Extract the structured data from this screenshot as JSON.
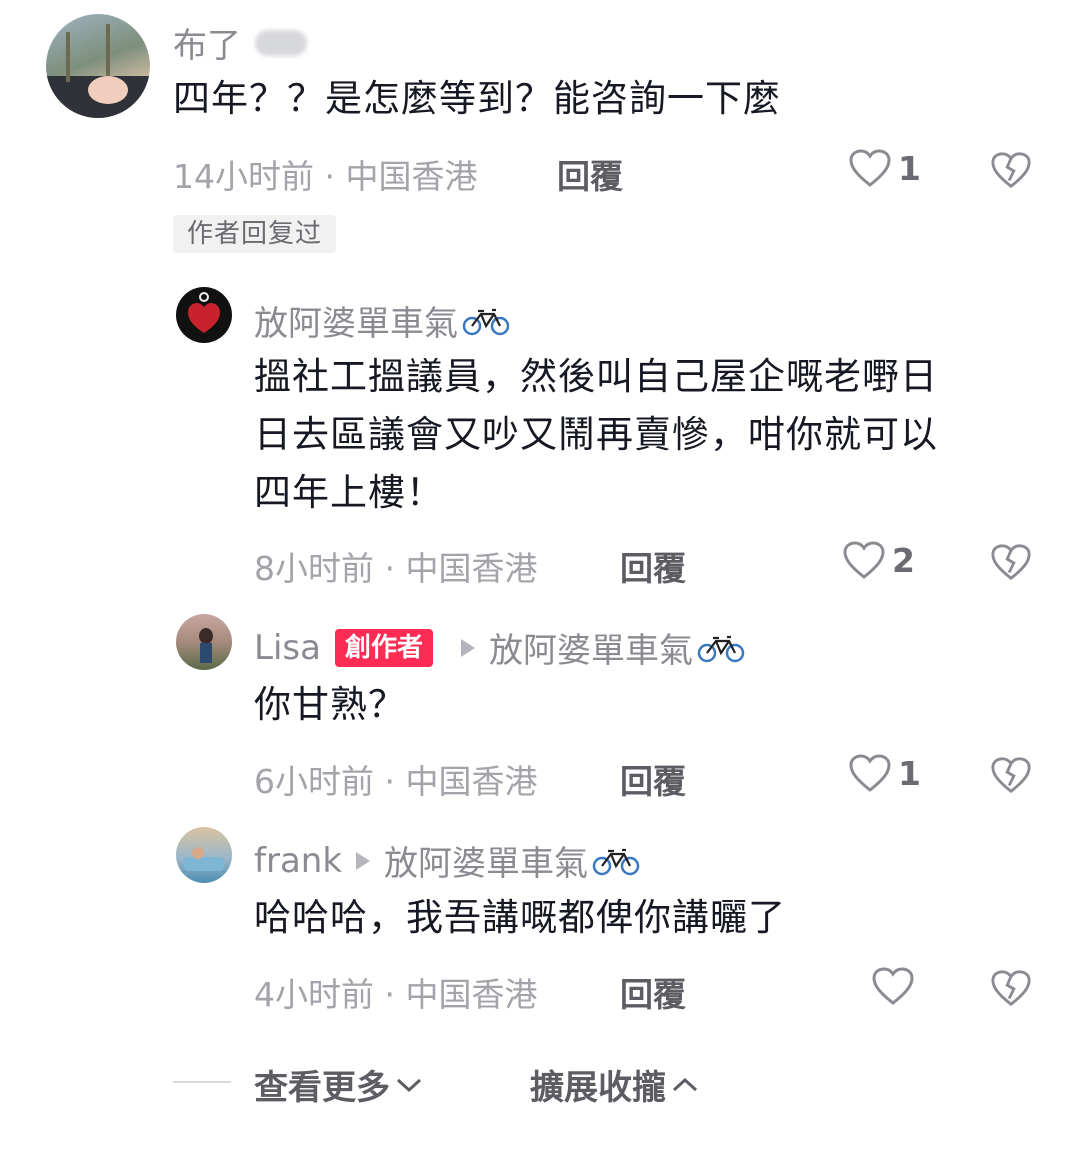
{
  "comments": [
    {
      "username": "布了",
      "text": "四年？？是怎麼等到？能咨詢一下麼",
      "time_location": "14小时前 · 中国香港",
      "reply_label": "回覆",
      "like_count": "1",
      "author_replied_tag": "作者回复过"
    },
    {
      "username": "放阿婆單車氣",
      "username_icon": "bicycle-emoji",
      "text_lines": [
        "搵社工搵議員，然後叫自己屋企嘅老嘢日",
        "日去區議會又吵又鬧再賣慘，咁你就可以",
        "四年上樓！"
      ],
      "time_location": "8小时前 · 中国香港",
      "reply_label": "回覆",
      "like_count": "2"
    },
    {
      "username": "Lisa",
      "badge": "創作者",
      "reply_to": "放阿婆單車氣",
      "text": "你甘熟？",
      "time_location": "6小时前 · 中国香港",
      "reply_label": "回覆",
      "like_count": "1"
    },
    {
      "username": "frank",
      "reply_to": "放阿婆單車氣",
      "text": "哈哈哈，我吾講嘅都俾你講曬了",
      "time_location": "4小时前 · 中国香港",
      "reply_label": "回覆",
      "like_count": ""
    }
  ],
  "footer": {
    "view_more": "查看更多",
    "collapse": "擴展收攏"
  },
  "colors": {
    "creator_badge": "#fe2c55",
    "meta_text": "#a3a4a9",
    "bicycle": "#3a78c2"
  }
}
